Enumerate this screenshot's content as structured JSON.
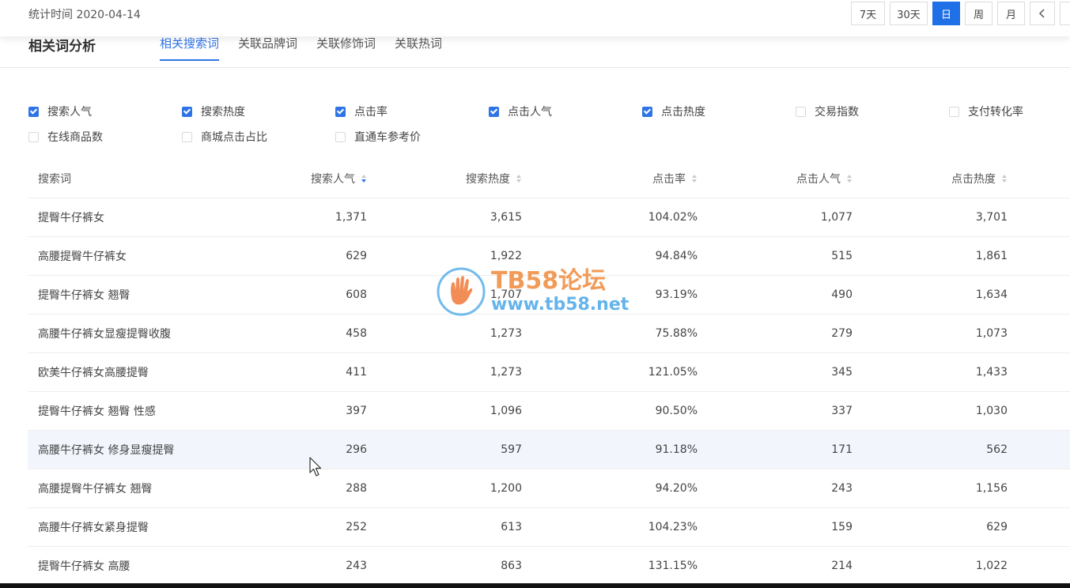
{
  "header": {
    "stat_time": "统计时间 2020-04-14",
    "range_buttons": [
      "7天",
      "30天",
      "日",
      "周",
      "月"
    ],
    "active_range": "日",
    "colors": {
      "accent": "#1f6fe6",
      "tab_active": "#2f74e6"
    }
  },
  "section": {
    "title": "相关词分析",
    "tabs": [
      "相关搜索词",
      "关联品牌词",
      "关联修饰词",
      "关联热词"
    ],
    "active_tab": "相关搜索词"
  },
  "metrics": [
    {
      "label": "搜索人气",
      "checked": true
    },
    {
      "label": "搜索热度",
      "checked": true
    },
    {
      "label": "点击率",
      "checked": true
    },
    {
      "label": "点击人气",
      "checked": true
    },
    {
      "label": "点击热度",
      "checked": true
    },
    {
      "label": "交易指数",
      "checked": false
    },
    {
      "label": "支付转化率",
      "checked": false
    },
    {
      "label": "在线商品数",
      "checked": false
    },
    {
      "label": "商城点击占比",
      "checked": false
    },
    {
      "label": "直通车参考价",
      "checked": false
    }
  ],
  "table": {
    "columns": [
      "搜索词",
      "搜索人气",
      "搜索热度",
      "点击率",
      "点击人气",
      "点击热度"
    ],
    "sorted_column": "搜索人气",
    "sort_direction": "desc",
    "rows": [
      [
        "提臀牛仔裤女",
        "1,371",
        "3,615",
        "104.02%",
        "1,077",
        "3,701"
      ],
      [
        "高腰提臀牛仔裤女",
        "629",
        "1,922",
        "94.84%",
        "515",
        "1,861"
      ],
      [
        "提臀牛仔裤女 翘臀",
        "608",
        "1,707",
        "93.19%",
        "490",
        "1,634"
      ],
      [
        "高腰牛仔裤女显瘦提臀收腹",
        "458",
        "1,273",
        "75.88%",
        "279",
        "1,073"
      ],
      [
        "欧美牛仔裤女高腰提臀",
        "411",
        "1,273",
        "121.05%",
        "345",
        "1,433"
      ],
      [
        "提臀牛仔裤女 翘臀 性感",
        "397",
        "1,096",
        "90.50%",
        "337",
        "1,030"
      ],
      [
        "高腰牛仔裤女 修身显瘦提臀",
        "296",
        "597",
        "91.18%",
        "171",
        "562"
      ],
      [
        "高腰提臀牛仔裤女 翘臀",
        "288",
        "1,200",
        "94.20%",
        "243",
        "1,156"
      ],
      [
        "高腰牛仔裤女紧身提臀",
        "252",
        "613",
        "104.23%",
        "159",
        "629"
      ],
      [
        "提臀牛仔裤女 高腰",
        "243",
        "863",
        "131.15%",
        "214",
        "1,022"
      ]
    ],
    "hover_row": 6
  },
  "watermark": {
    "title": "TB58论坛",
    "url": "www.tb58.net"
  }
}
